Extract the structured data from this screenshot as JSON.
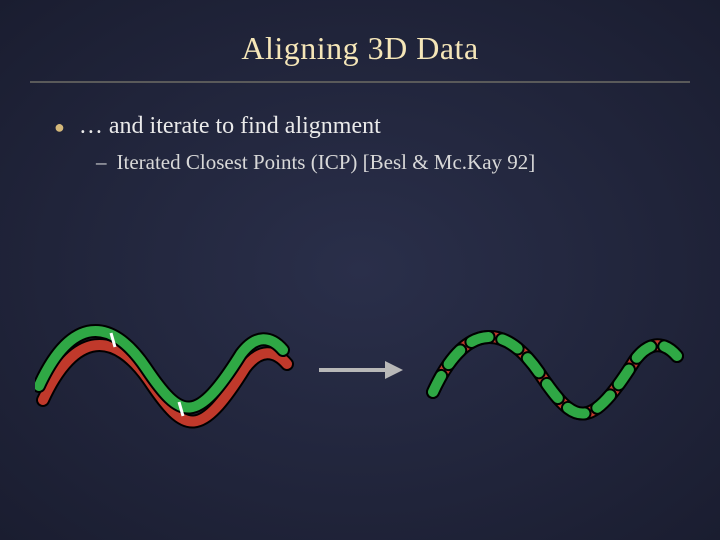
{
  "title": "Aligning 3D Data",
  "bullets": {
    "main": "… and iterate to find alignment",
    "sub": "Iterated Closest Points (ICP) [Besl & Mc.Kay 92]"
  },
  "colors": {
    "title": "#f5e6b8",
    "curve_green": "#2fa845",
    "curve_red": "#c0392b",
    "arrow": "#b8b8b8",
    "tick": "#ffffff"
  }
}
